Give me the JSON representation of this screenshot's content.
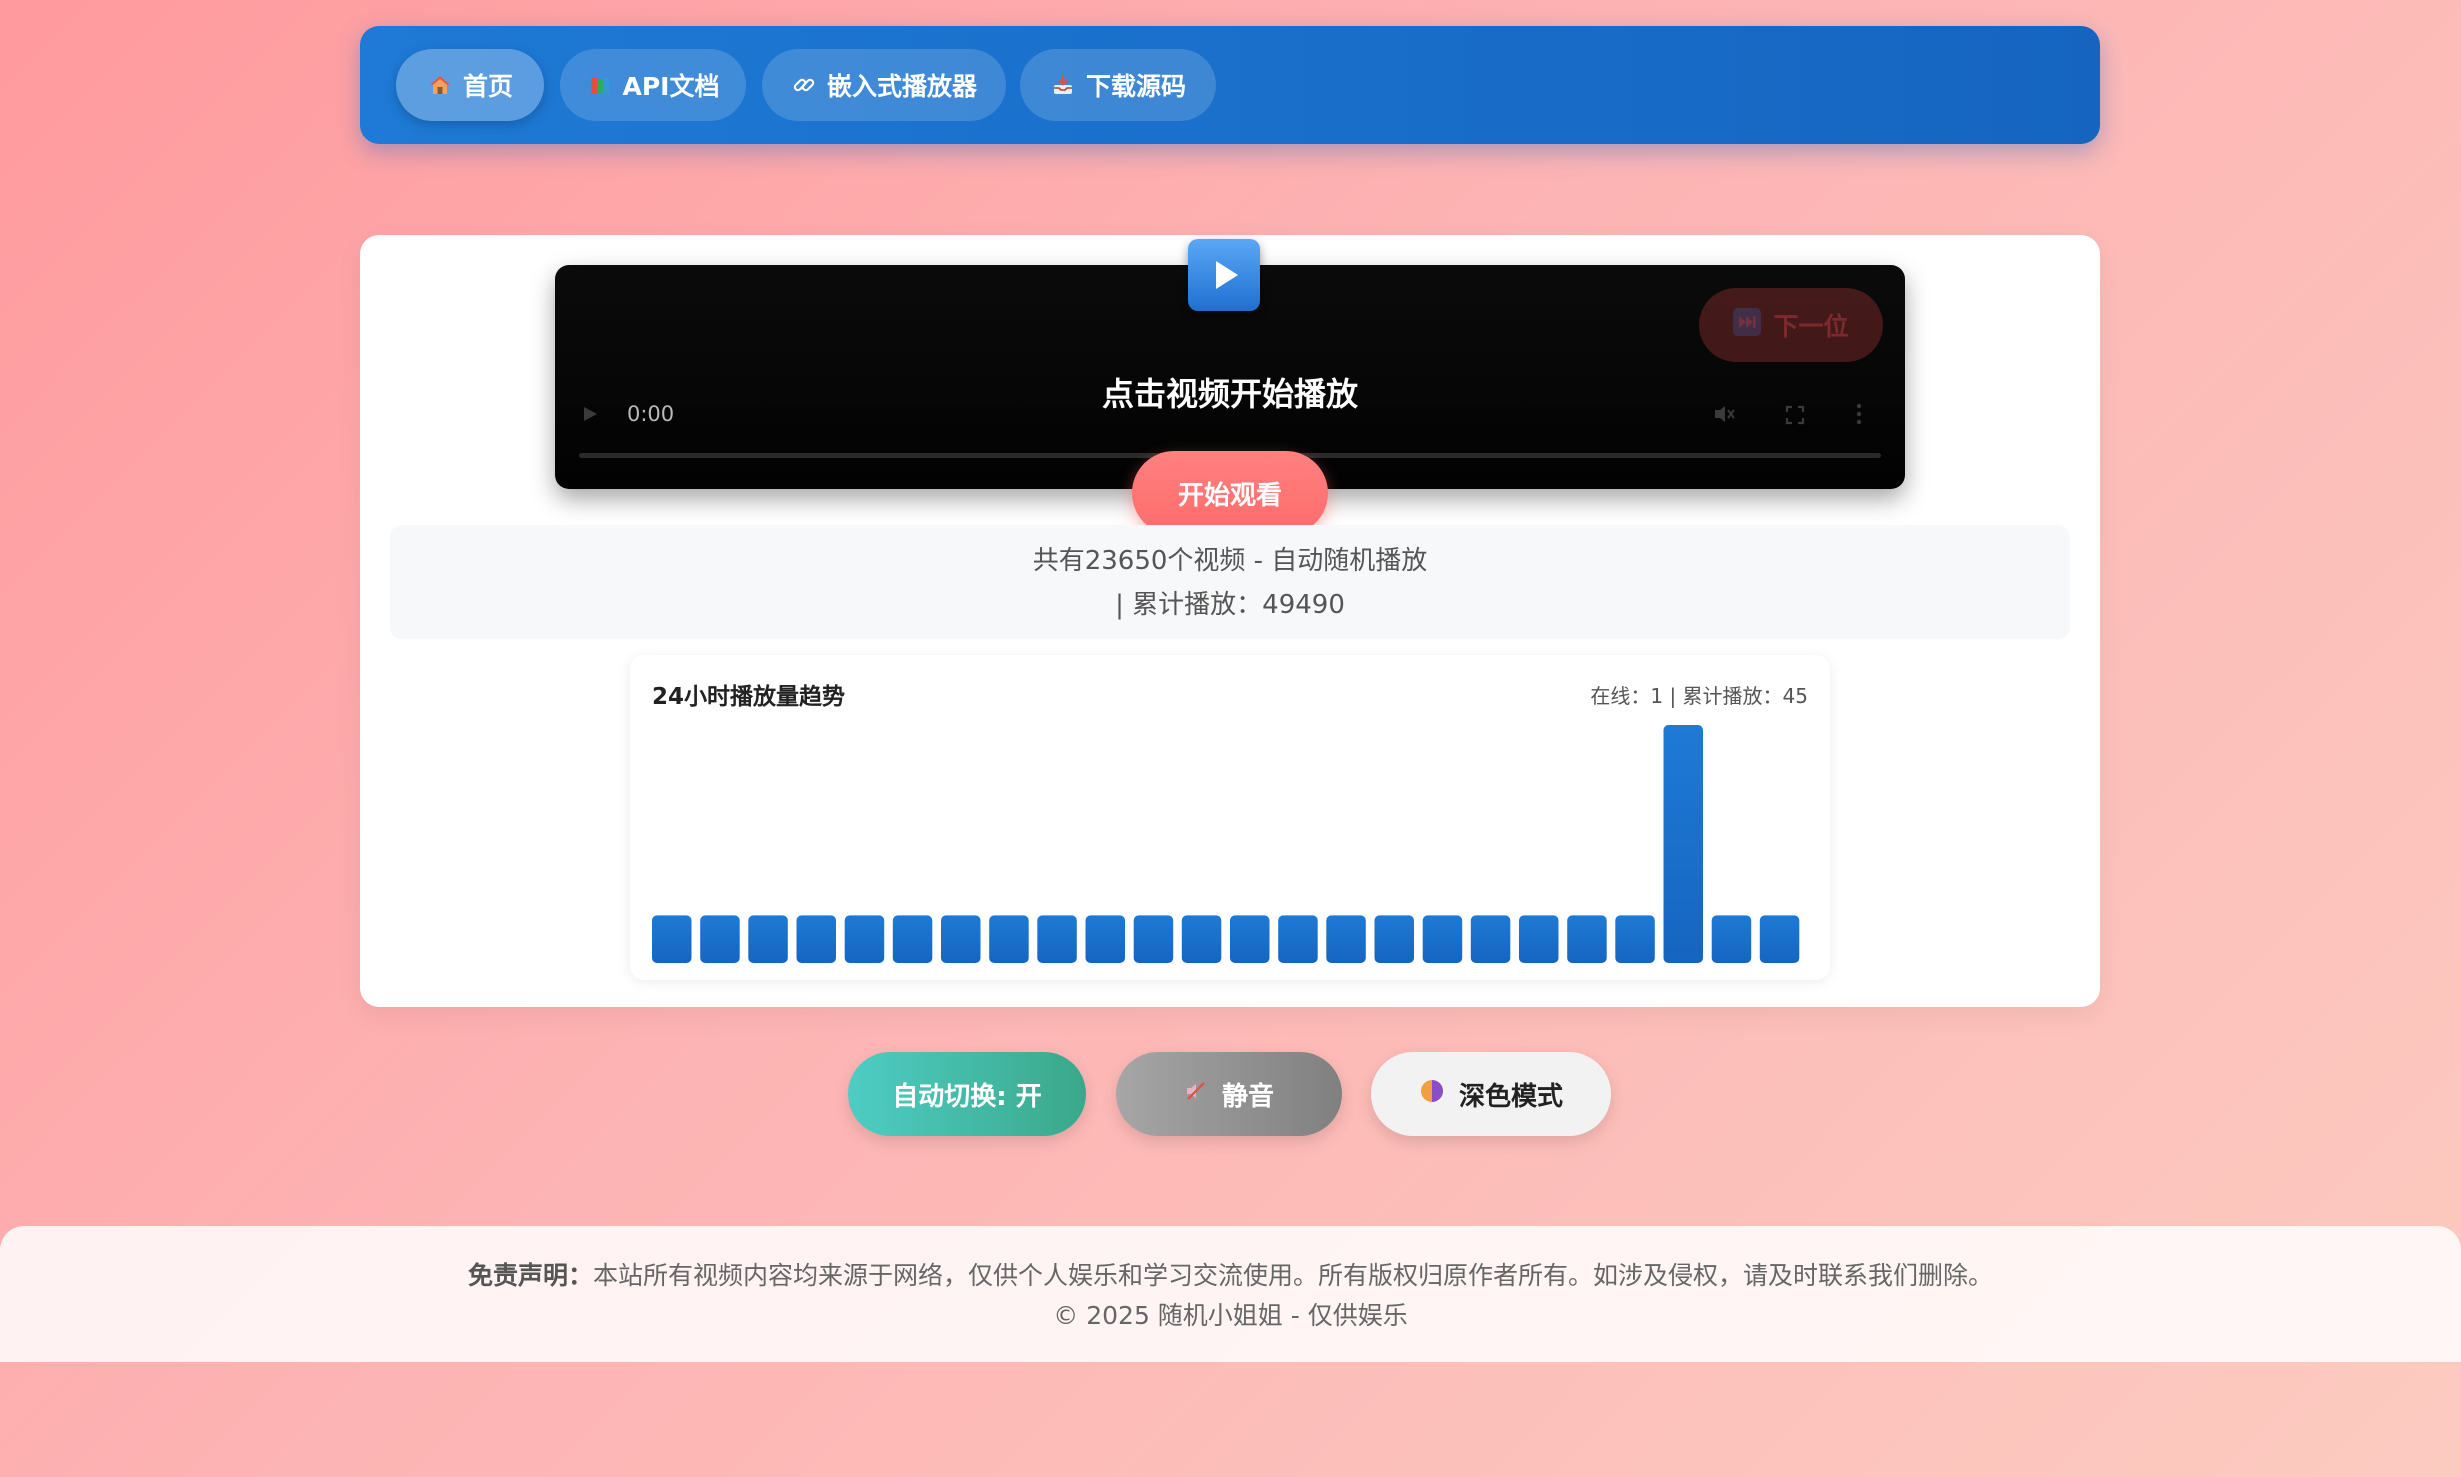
{
  "nav": {
    "items": [
      {
        "icon": "home-icon",
        "label": "首页",
        "active": true
      },
      {
        "icon": "books-icon",
        "label": "API文档",
        "active": false
      },
      {
        "icon": "link-icon",
        "label": "嵌入式播放器",
        "active": false
      },
      {
        "icon": "inbox-download-icon",
        "label": "下载源码",
        "active": false
      }
    ]
  },
  "video": {
    "hint": "点击视频开始播放",
    "next_label": "下一位",
    "time": "0:00",
    "start_label": "开始观看"
  },
  "info": {
    "line1": "共有23650个视频 - 自动随机播放",
    "line2": "| 累计播放：49490"
  },
  "chart_data": {
    "type": "bar",
    "title": "24小时播放量趋势",
    "stats": "在线：1 | 累计播放：45",
    "values": [
      1,
      1,
      1,
      1,
      1,
      1,
      1,
      1,
      1,
      1,
      1,
      1,
      1,
      1,
      1,
      1,
      1,
      1,
      1,
      1,
      1,
      5,
      1,
      1
    ],
    "ylim": [
      0,
      5
    ],
    "bar_color": "#1565c0"
  },
  "controls": {
    "auto_label": "自动切换: 开",
    "mute_label": "静音",
    "dark_label": "深色模式"
  },
  "footer": {
    "disclaimer_title": "免责声明：",
    "disclaimer_text": "本站所有视频内容均来源于网络，仅供个人娱乐和学习交流使用。所有版权归原作者所有。如涉及侵权，请及时联系我们删除。",
    "copyright": "© 2025 随机小姐姐 - 仅供娱乐"
  }
}
